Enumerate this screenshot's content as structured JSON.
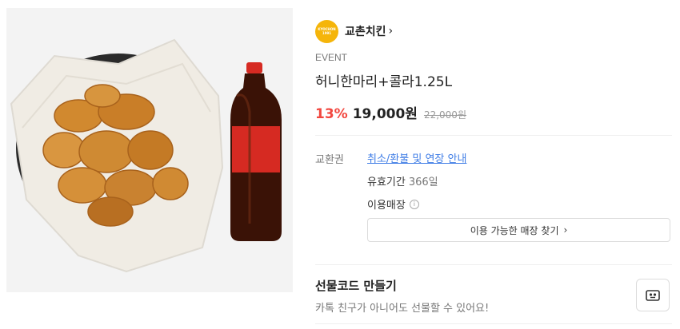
{
  "product_image": {
    "icon": "fried-chicken-and-cola-photo"
  },
  "brand": {
    "name": "교촌치킨",
    "logo_icon": "kyochon-logo",
    "chevron": "›",
    "logo_color": "#f5b50a"
  },
  "event_label": "EVENT",
  "title": "허니한마리+콜라1.25L",
  "price": {
    "discount": "13%",
    "sale": "19,000원",
    "original": "22,000원",
    "discount_color": "#f2473f"
  },
  "details": {
    "label": "교환권",
    "refund_link": "취소/환불 및 연장 안내",
    "validity_label": "유효기간",
    "validity_value": "366일",
    "store_label": "이용매장",
    "store_button": "이용 가능한 매장 찾기",
    "store_button_chevron": "›"
  },
  "gift": {
    "title": "선물코드 만들기",
    "description": "카톡 친구가 아니어도 선물할 수 있어요!",
    "button_icon": "gift-code-icon"
  }
}
